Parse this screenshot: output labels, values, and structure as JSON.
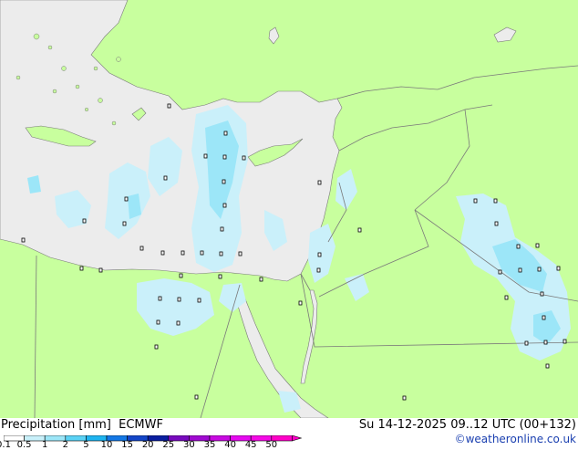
{
  "footer": {
    "title": "Precipitation [mm]",
    "model": "ECMWF",
    "datetime": "Su 14-12-2025 09..12 UTC (00+132)",
    "credit": "©weatheronline.co.uk"
  },
  "legend": {
    "labels": [
      "0.1",
      "0.5",
      "1",
      "2",
      "5",
      "10",
      "15",
      "20",
      "25",
      "30",
      "35",
      "40",
      "45",
      "50"
    ],
    "colors": [
      "#ffffff",
      "#c8f0fa",
      "#9ce6f8",
      "#5ad2f5",
      "#1eb4f0",
      "#1478e6",
      "#1446c8",
      "#0a1ea0",
      "#780abe",
      "#a00ad2",
      "#c80ae1",
      "#e60af0",
      "#f50ae6",
      "#ff00c8"
    ]
  },
  "map": {
    "land_color": "#c8ff9e",
    "sea_color": "#ececec",
    "border_color": "#7a7a7a",
    "precip_light_color": "#caf0fa",
    "precip_medium_color": "#9ce6f8"
  }
}
